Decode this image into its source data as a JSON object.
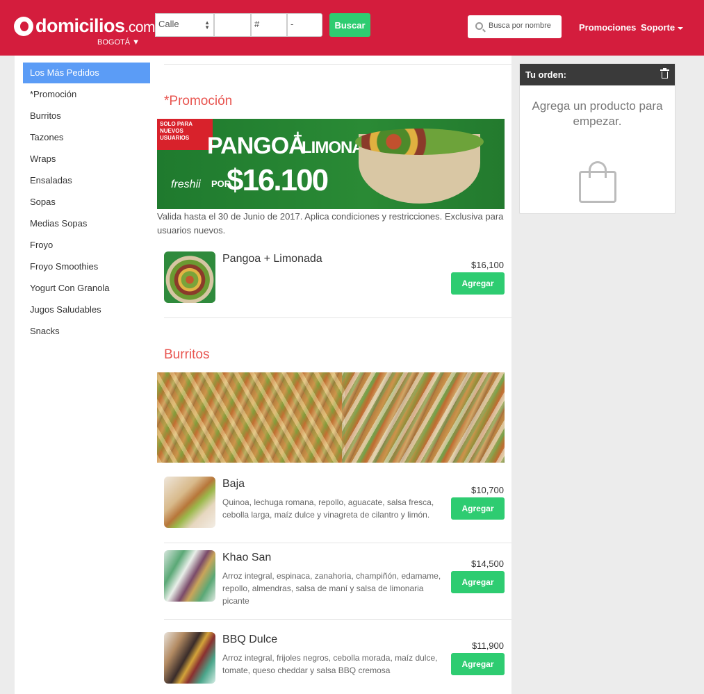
{
  "header": {
    "logo_main": "domicilios",
    "logo_tld": ".com",
    "city": "BOGOTÁ",
    "address": {
      "street_value": "Calle",
      "num1_value": "",
      "num2_placeholder": "#",
      "num3_placeholder": "-"
    },
    "search_button": "Buscar",
    "search_placeholder": "Busca por nombre",
    "nav_promociones": "Promociones",
    "nav_soporte": "Soporte"
  },
  "sidebar": {
    "items": [
      {
        "label": "Los Más Pedidos",
        "active": true
      },
      {
        "label": "*Promoción"
      },
      {
        "label": "Burritos"
      },
      {
        "label": "Tazones"
      },
      {
        "label": "Wraps"
      },
      {
        "label": "Ensaladas"
      },
      {
        "label": "Sopas"
      },
      {
        "label": "Medias Sopas"
      },
      {
        "label": "Froyo"
      },
      {
        "label": "Froyo Smoothies"
      },
      {
        "label": "Yogurt Con Granola"
      },
      {
        "label": "Jugos Saludables"
      },
      {
        "label": "Snacks"
      }
    ]
  },
  "sections": {
    "promocion": {
      "title": "*Promoción",
      "banner": {
        "tag": "SOLO PARA NUEVOS USUARIOS",
        "headline_left": "PANGOA",
        "headline_right": "LIMONADA",
        "por": "POR",
        "price": "$16.100",
        "brand": "freshii"
      },
      "note": "Valida hasta el 30 de Junio de 2017. Aplica condiciones y restricciones. Exclusiva para usuarios nuevos.",
      "products": [
        {
          "name": "Pangoa + Limonada",
          "price": "$16,100",
          "button": "Agregar"
        }
      ]
    },
    "burritos": {
      "title": "Burritos",
      "products": [
        {
          "name": "Baja",
          "desc": "Quinoa, lechuga romana, repollo, aguacate, salsa fresca, cebolla larga, maíz dulce y vinagreta de cilantro y limón.",
          "price": "$10,700",
          "button": "Agregar"
        },
        {
          "name": "Khao San",
          "desc": "Arroz integral, espinaca, zanahoria, champiñón, edamame, repollo, almendras, salsa de maní y salsa de limonaria picante",
          "price": "$14,500",
          "button": "Agregar"
        },
        {
          "name": "BBQ Dulce",
          "desc": "Arroz integral, frijoles negros, cebolla morada, maíz dulce, tomate, queso cheddar y salsa BBQ cremosa",
          "price": "$11,900",
          "button": "Agregar"
        }
      ]
    }
  },
  "order": {
    "title": "Tu orden:",
    "empty_text": "Agrega un producto para empezar."
  },
  "colors": {
    "brand_red": "#d41d3d",
    "accent_green": "#2ecc71",
    "active_blue": "#5b9cf6",
    "section_title": "#e8544f"
  },
  "icons": [
    "logo-icon",
    "search-icon",
    "caret-down-icon",
    "trash-icon",
    "shopping-bag-icon"
  ]
}
